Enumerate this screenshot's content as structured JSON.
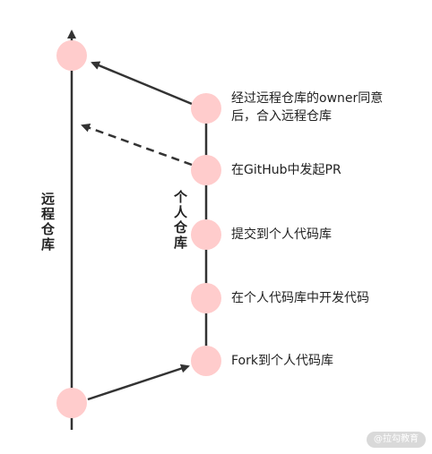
{
  "colors": {
    "node_fill": "#ffcccc",
    "line": "#333333"
  },
  "labels": {
    "remote_repo": "远程仓库",
    "personal_repo": "个人仓库"
  },
  "steps": [
    {
      "text": "Fork到个人代码库"
    },
    {
      "text": "在个人代码库中开发代码"
    },
    {
      "text": "提交到个人代码库"
    },
    {
      "text": "在GitHub中发起PR"
    },
    {
      "text": "经过远程仓库的owner同意后，合入远程仓库"
    }
  ],
  "watermark": "@拉勾教育"
}
